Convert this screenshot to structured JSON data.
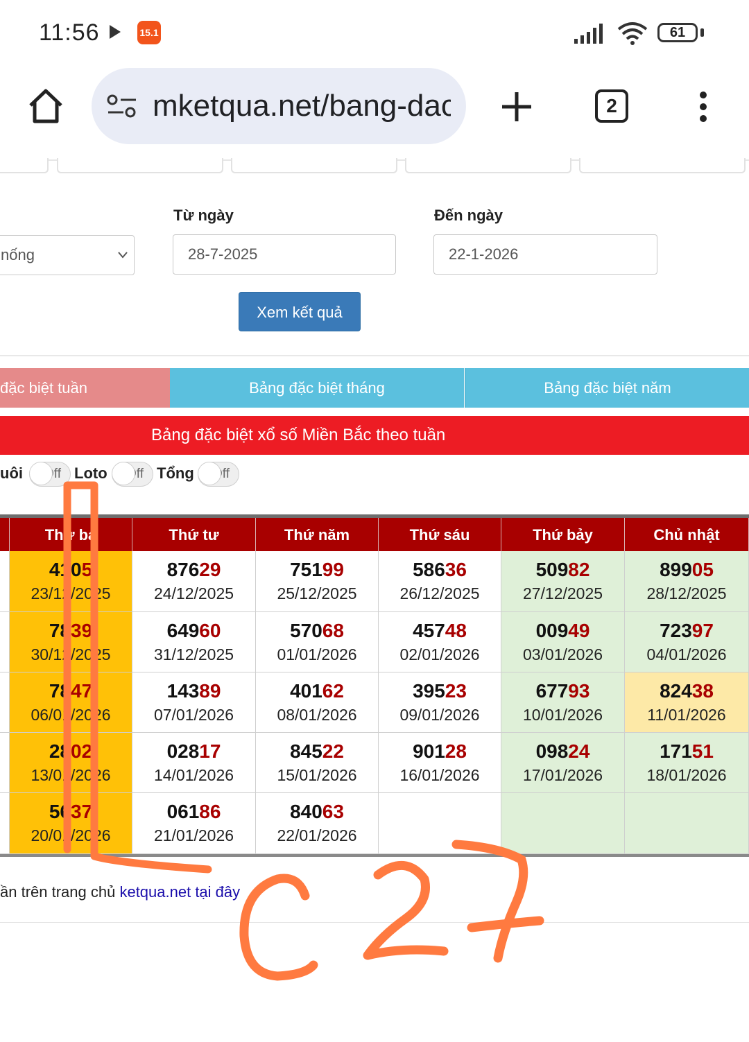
{
  "status": {
    "time": "11:56",
    "battery": "61",
    "shopee_label": "15.1"
  },
  "browser": {
    "url": "mketqua.net/bang-dac",
    "tab_count": "2"
  },
  "form": {
    "select_value": "nống",
    "from_label": "Từ ngày",
    "from_value": "28-7-2025",
    "to_label": "Đến ngày",
    "to_value": "22-1-2026",
    "submit": "Xem kết quả"
  },
  "tabs": [
    {
      "label": "đặc biệt tuần",
      "color": "#e58a8a"
    },
    {
      "label": "Bảng đặc biệt tháng",
      "color": "#5bc0de"
    },
    {
      "label": "Bảng đặc biệt năm",
      "color": "#5bc0de"
    }
  ],
  "banner": "Bảng đặc biệt xổ số Miền Bắc theo tuần",
  "toggles": {
    "duoi_label": "uôi",
    "loto_label": "Loto",
    "tong_label": "Tổng",
    "off": "Off"
  },
  "table": {
    "headers": [
      "Thứ ba",
      "Thứ tư",
      "Thứ năm",
      "Thứ sáu",
      "Thứ bảy",
      "Chủ nhật"
    ],
    "rows": [
      [
        {
          "head": "410",
          "tail": "5",
          "date": "23/12/2025",
          "bg": "#ffc107"
        },
        {
          "head": "876",
          "tail": "29",
          "date": "24/12/2025",
          "bg": "#ffffff"
        },
        {
          "head": "751",
          "tail": "99",
          "date": "25/12/2025",
          "bg": "#ffffff"
        },
        {
          "head": "586",
          "tail": "36",
          "date": "26/12/2025",
          "bg": "#ffffff"
        },
        {
          "head": "509",
          "tail": "82",
          "date": "27/12/2025",
          "bg": "#dff0d8"
        },
        {
          "head": "899",
          "tail": "05",
          "date": "28/12/2025",
          "bg": "#dff0d8"
        }
      ],
      [
        {
          "head": "78",
          "tail": "39",
          "date": "30/12/2025",
          "bg": "#ffc107"
        },
        {
          "head": "649",
          "tail": "60",
          "date": "31/12/2025",
          "bg": "#ffffff"
        },
        {
          "head": "570",
          "tail": "68",
          "date": "01/01/2026",
          "bg": "#ffffff"
        },
        {
          "head": "457",
          "tail": "48",
          "date": "02/01/2026",
          "bg": "#ffffff"
        },
        {
          "head": "009",
          "tail": "49",
          "date": "03/01/2026",
          "bg": "#dff0d8"
        },
        {
          "head": "723",
          "tail": "97",
          "date": "04/01/2026",
          "bg": "#dff0d8"
        }
      ],
      [
        {
          "head": "78",
          "tail": "47",
          "date": "06/01/2026",
          "bg": "#ffc107"
        },
        {
          "head": "143",
          "tail": "89",
          "date": "07/01/2026",
          "bg": "#ffffff"
        },
        {
          "head": "401",
          "tail": "62",
          "date": "08/01/2026",
          "bg": "#ffffff"
        },
        {
          "head": "395",
          "tail": "23",
          "date": "09/01/2026",
          "bg": "#ffffff"
        },
        {
          "head": "677",
          "tail": "93",
          "date": "10/01/2026",
          "bg": "#dff0d8"
        },
        {
          "head": "824",
          "tail": "38",
          "date": "11/01/2026",
          "bg": "#fde9a7"
        }
      ],
      [
        {
          "head": "28",
          "tail": "02",
          "date": "13/01/2026",
          "bg": "#ffc107"
        },
        {
          "head": "028",
          "tail": "17",
          "date": "14/01/2026",
          "bg": "#ffffff"
        },
        {
          "head": "845",
          "tail": "22",
          "date": "15/01/2026",
          "bg": "#ffffff"
        },
        {
          "head": "901",
          "tail": "28",
          "date": "16/01/2026",
          "bg": "#ffffff"
        },
        {
          "head": "098",
          "tail": "24",
          "date": "17/01/2026",
          "bg": "#dff0d8"
        },
        {
          "head": "171",
          "tail": "51",
          "date": "18/01/2026",
          "bg": "#dff0d8"
        }
      ],
      [
        {
          "head": "56",
          "tail": "37",
          "date": "20/01/2026",
          "bg": "#ffc107"
        },
        {
          "head": "061",
          "tail": "86",
          "date": "21/01/2026",
          "bg": "#ffffff"
        },
        {
          "head": "840",
          "tail": "63",
          "date": "22/01/2026",
          "bg": "#ffffff"
        },
        {
          "head": "",
          "tail": "",
          "date": "",
          "bg": "#ffffff"
        },
        {
          "head": "",
          "tail": "",
          "date": "",
          "bg": "#dff0d8"
        },
        {
          "head": "",
          "tail": "",
          "date": "",
          "bg": "#dff0d8"
        }
      ]
    ]
  },
  "footer": {
    "prefix": "ần trên trang chủ ",
    "link": "ketqua.net tại đây"
  },
  "annotation": {
    "handwritten": "C27",
    "color": "#ff7a40"
  }
}
